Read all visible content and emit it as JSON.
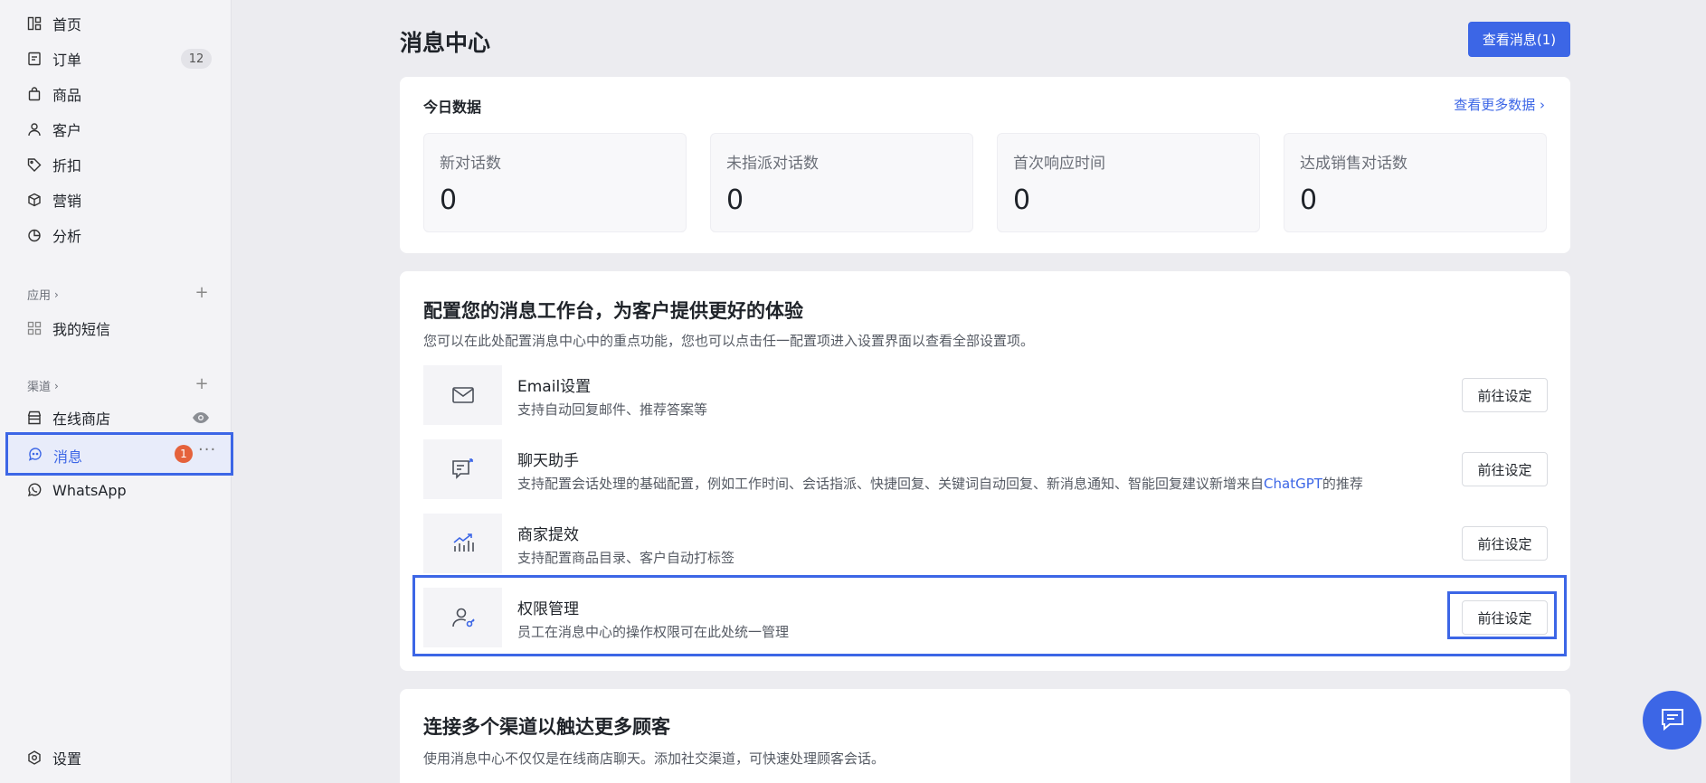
{
  "sidebar": {
    "nav": [
      {
        "label": "首页",
        "icon": "dashboard-icon"
      },
      {
        "label": "订单",
        "icon": "order-icon",
        "count": "12"
      },
      {
        "label": "商品",
        "icon": "bag-icon"
      },
      {
        "label": "客户",
        "icon": "person-icon"
      },
      {
        "label": "折扣",
        "icon": "tag-icon"
      },
      {
        "label": "营销",
        "icon": "cube-icon"
      },
      {
        "label": "分析",
        "icon": "pie-icon"
      }
    ],
    "apps_label": "应用",
    "app_item": "我的短信",
    "channels_label": "渠道",
    "channels": {
      "online_store": "在线商店",
      "messages": "消息",
      "messages_badge": "1",
      "whatsapp": "WhatsApp"
    },
    "settings": "设置"
  },
  "header": {
    "title": "消息中心",
    "view_messages_button": "查看消息(1)"
  },
  "today": {
    "title": "今日数据",
    "more_link": "查看更多数据",
    "stats": [
      {
        "label": "新对话数",
        "value": "0"
      },
      {
        "label": "未指派对话数",
        "value": "0"
      },
      {
        "label": "首次响应时间",
        "value": "0"
      },
      {
        "label": "达成销售对话数",
        "value": "0"
      }
    ]
  },
  "config": {
    "title": "配置您的消息工作台，为客户提供更好的体验",
    "description": "您可以在此处配置消息中心中的重点功能，您也可以点击任一配置项进入设置界面以查看全部设置项。",
    "items": [
      {
        "title": "Email设置",
        "desc": "支持自动回复邮件、推荐答案等",
        "button": "前往设定",
        "icon": "mail-icon"
      },
      {
        "title": "聊天助手",
        "desc": "支持配置会话处理的基础配置，例如工作时间、会话指派、快捷回复、关键词自动回复、新消息通知、智能回复建议新增来自",
        "desc_link": "ChatGPT",
        "desc_suffix": "的推荐",
        "button": "前往设定",
        "icon": "chat-assistant-icon"
      },
      {
        "title": "商家提效",
        "desc": "支持配置商品目录、客户自动打标签",
        "button": "前往设定",
        "icon": "growth-chart-icon"
      },
      {
        "title": "权限管理",
        "desc": "员工在消息中心的操作权限可在此处统一管理",
        "button": "前往设定",
        "icon": "user-key-icon"
      }
    ]
  },
  "channels_card": {
    "title": "连接多个渠道以触达更多顾客",
    "description": "使用消息中心不仅仅是在线商店聊天。添加社交渠道，可快速处理顾客会话。"
  },
  "colors": {
    "accent": "#3c66e6",
    "badge": "#e5623c"
  }
}
